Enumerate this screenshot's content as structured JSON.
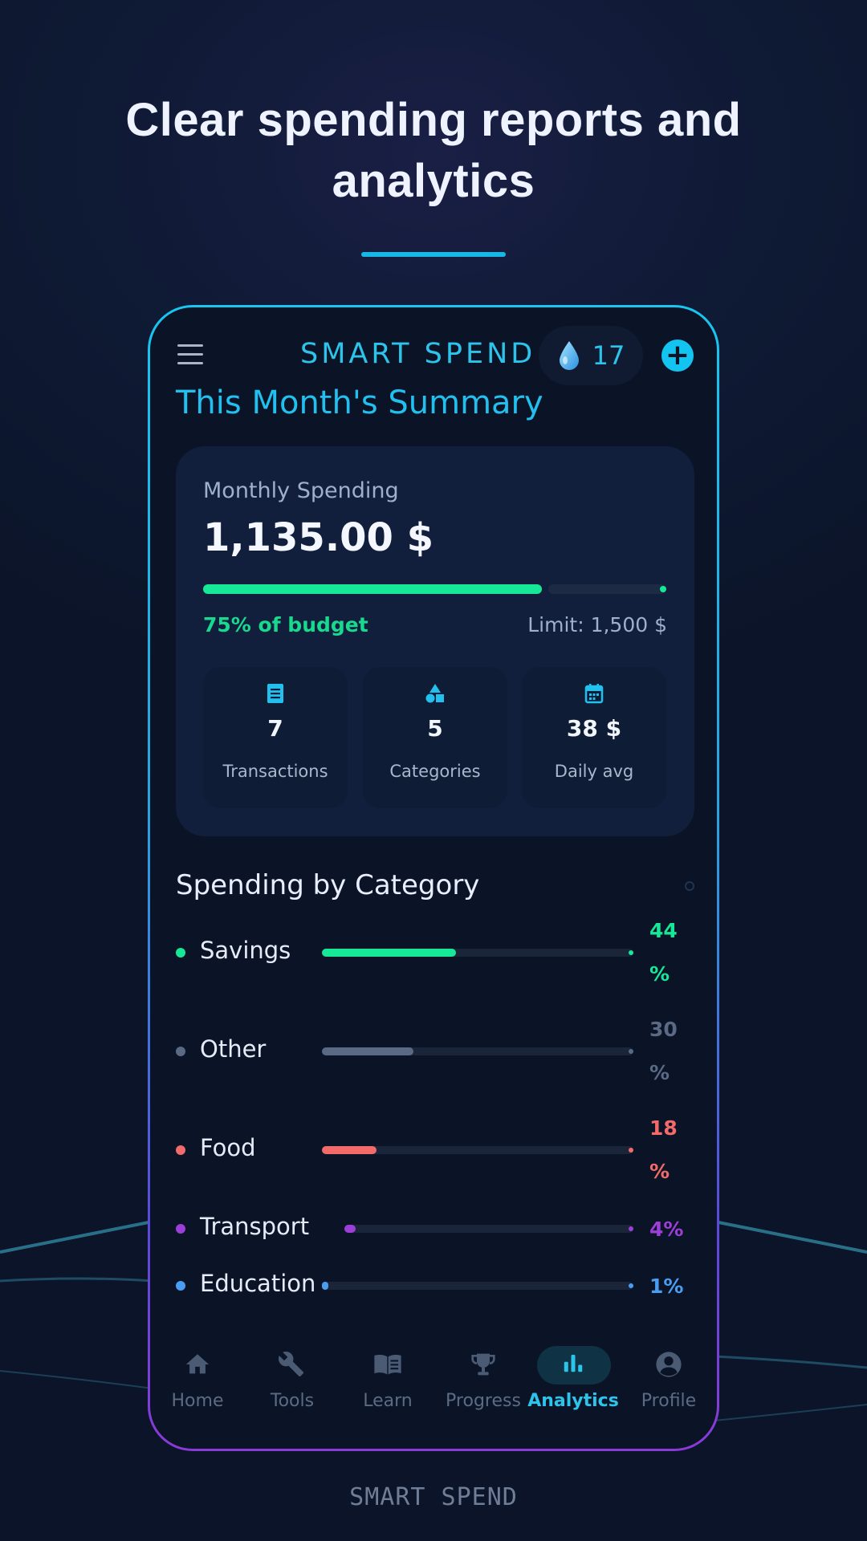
{
  "headline": {
    "line1": "Clear spending reports and",
    "line2": "analytics"
  },
  "app": {
    "brand": "SMART SPEND",
    "drops_count": "17",
    "add_label": "+"
  },
  "summary": {
    "title": "This Month's Summary",
    "monthly_label": "Monthly Spending",
    "amount": "1,135.00 $",
    "budget_used_fraction": 0.75,
    "pct_label": "75% of budget",
    "limit_label": "Limit: 1,500 $",
    "stats": [
      {
        "icon": "receipt-icon",
        "value": "7",
        "label": "Transactions"
      },
      {
        "icon": "shapes-icon",
        "value": "5",
        "label": "Categories"
      },
      {
        "icon": "calendar-icon",
        "value": "38 $",
        "label": "Daily avg"
      }
    ]
  },
  "categories": {
    "title": "Spending by Category",
    "items": [
      {
        "name": "Savings",
        "percent": 44,
        "pct_label": "44 %",
        "color": "#17e897"
      },
      {
        "name": "Other",
        "percent": 30,
        "pct_label": "30 %",
        "color": "#5a6a84"
      },
      {
        "name": "Food",
        "percent": 18,
        "pct_label": "18 %",
        "color": "#f26a6a"
      },
      {
        "name": "Transport",
        "percent": 4,
        "pct_label": "4%",
        "color": "#9b3fd8"
      },
      {
        "name": "Education",
        "percent": 1,
        "pct_label": "1%",
        "color": "#4a9ef2"
      }
    ]
  },
  "nav": {
    "items": [
      {
        "label": "Home",
        "icon": "home-icon"
      },
      {
        "label": "Tools",
        "icon": "wrench-icon"
      },
      {
        "label": "Learn",
        "icon": "book-icon"
      },
      {
        "label": "Progress",
        "icon": "trophy-icon"
      },
      {
        "label": "Analytics",
        "icon": "bar-chart-icon",
        "active": true
      },
      {
        "label": "Profile",
        "icon": "profile-icon"
      }
    ]
  },
  "footer": {
    "brand": "SMART SPEND"
  },
  "colors": {
    "accent": "#2cc4ea",
    "success": "#17e897",
    "background": "#0b1326"
  }
}
